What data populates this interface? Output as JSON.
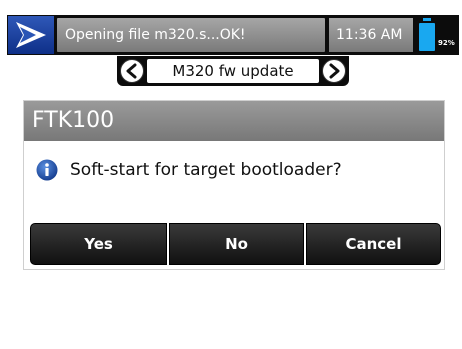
{
  "status_bar": {
    "logo_icon": "logo-icon",
    "message": "Opening file m320.s...OK!",
    "time": "11:36 AM",
    "battery": {
      "percent_label": "92%",
      "level": 0.92,
      "color": "#19a8f0"
    }
  },
  "navigation": {
    "title": "M320 fw update",
    "prev_icon": "arrow-left-icon",
    "next_icon": "arrow-right-icon"
  },
  "dialog": {
    "title": "FTK100",
    "icon": "info-icon",
    "message": "Soft-start for target bootloader?",
    "buttons": {
      "yes": "Yes",
      "no": "No",
      "cancel": "Cancel"
    }
  },
  "colors": {
    "accent_blue": "#2f58b8",
    "header_gray": "#8c8c8c",
    "button_dark": "#222222"
  }
}
